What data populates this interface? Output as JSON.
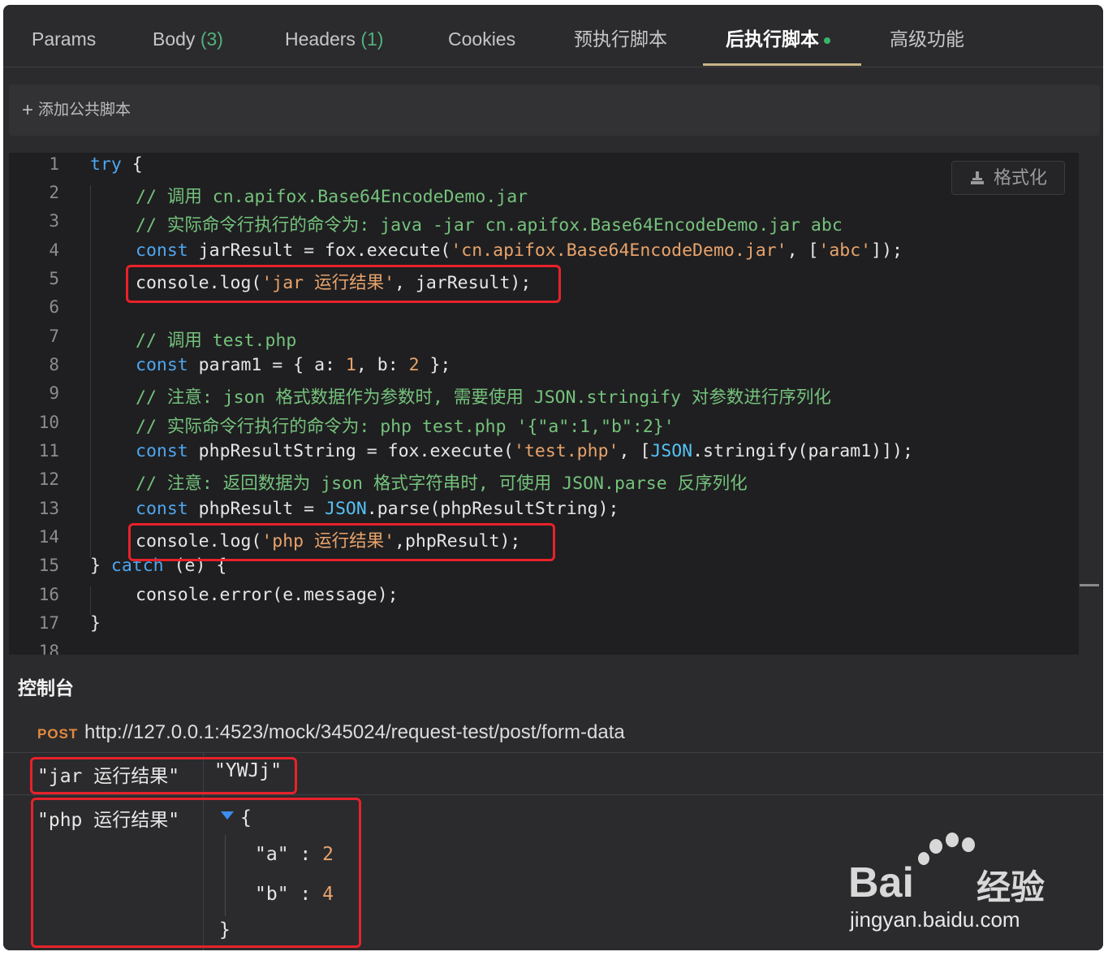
{
  "tabs": [
    {
      "label": "Params",
      "count": ""
    },
    {
      "label": "Body",
      "count": "(3)"
    },
    {
      "label": "Headers",
      "count": "(1)"
    },
    {
      "label": "Cookies",
      "count": ""
    },
    {
      "label": "预执行脚本",
      "count": ""
    },
    {
      "label": "后执行脚本",
      "count": "",
      "active": true
    },
    {
      "label": "高级功能",
      "count": ""
    }
  ],
  "add_common_script": "添加公共脚本",
  "editor": {
    "format_button": "格式化",
    "line_numbers": [
      "1",
      "2",
      "3",
      "4",
      "5",
      "6",
      "7",
      "8",
      "9",
      "10",
      "11",
      "12",
      "13",
      "14",
      "15",
      "16",
      "17",
      "18"
    ],
    "lines": {
      "l1": {
        "kw": "try",
        "rest": " {"
      },
      "l2": "// 调用 cn.apifox.Base64EncodeDemo.jar",
      "l3": "// 实际命令行执行的命令为: java -jar cn.apifox.Base64EncodeDemo.jar abc",
      "l4": {
        "kw": "const",
        "a": " jarResult = fox.execute(",
        "s1": "'cn.apifox.Base64EncodeDemo.jar'",
        "b": ", [",
        "s2": "'abc'",
        "c": "]);"
      },
      "l5": {
        "a": "console.log(",
        "s1": "'jar 运行结果'",
        "b": ", jarResult);"
      },
      "l7": "// 调用 test.php",
      "l8": {
        "kw": "const",
        "a": " param1 = { a: ",
        "n1": "1",
        "b": ", b: ",
        "n2": "2",
        "c": " };"
      },
      "l9": "// 注意: json 格式数据作为参数时, 需要使用 JSON.stringify 对参数进行序列化",
      "l10": "// 实际命令行执行的命令为: php test.php '{\"a\":1,\"b\":2}'",
      "l11": {
        "kw": "const",
        "a": " phpResultString = fox.execute(",
        "s1": "'test.php'",
        "b": ", [",
        "obj": "JSON",
        "c": ".stringify(param1)]);"
      },
      "l12": "// 注意: 返回数据为 json 格式字符串时, 可使用 JSON.parse 反序列化",
      "l13": {
        "kw": "const",
        "a": " phpResult = ",
        "obj": "JSON",
        "b": ".parse(phpResultString);"
      },
      "l14": {
        "a": "console.log(",
        "s1": "'php 运行结果'",
        "b": ",phpResult);"
      },
      "l15": {
        "a": "} ",
        "kw": "catch",
        "b": " (e) {"
      },
      "l16": "console.error(e.message);",
      "l17": "}"
    }
  },
  "console": {
    "title": "控制台",
    "method": "POST",
    "url": "http://127.0.0.1:4523/mock/345024/request-test/post/form-data",
    "log1": {
      "label": "\"jar 运行结果\"",
      "value": "\"YWJj\""
    },
    "log2": {
      "label": "\"php 运行结果\"",
      "open": "{",
      "entries": [
        {
          "key": "\"a\"",
          "sep": " : ",
          "value": "2"
        },
        {
          "key": "\"b\"",
          "sep": " : ",
          "value": "4"
        }
      ],
      "close": "}"
    }
  },
  "watermark": {
    "logo": "Bai",
    "logo_cn": "经验",
    "url": "jingyan.baidu.com"
  },
  "colors": {
    "accent_underline": "#c9b487",
    "highlight_box": "#e8222a",
    "keyword": "#4ea6f0",
    "comment": "#75c27c",
    "string": "#e8a36b"
  }
}
